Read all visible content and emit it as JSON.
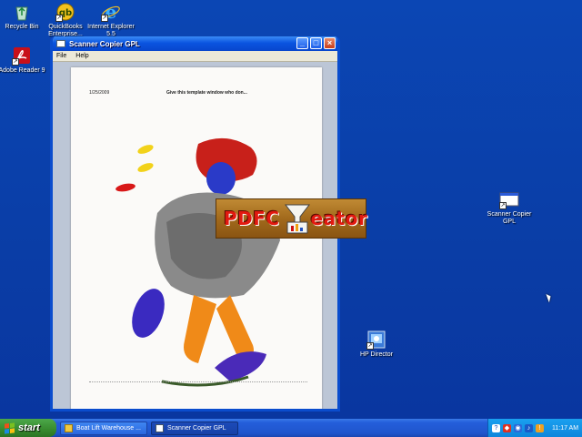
{
  "desktop": {
    "icons": [
      {
        "label": "Recycle Bin",
        "icon": "recycle-bin-icon"
      },
      {
        "label": "QuickBooks Enterprise...",
        "icon": "quickbooks-icon"
      },
      {
        "label": "Internet Explorer 5.5",
        "icon": "internet-explorer-icon"
      },
      {
        "label": "Adobe Reader 9",
        "icon": "adobe-reader-icon"
      },
      {
        "label": "Scanner Copier GPL",
        "icon": "scanner-copier-icon"
      },
      {
        "label": "HP Director",
        "icon": "hp-director-icon"
      }
    ]
  },
  "window": {
    "title": "Scanner Copier GPL",
    "minimize": "_",
    "maximize": "□",
    "close": "×",
    "menu": [
      "File",
      "Help"
    ],
    "document": {
      "date": "1/25/2009",
      "heading": "Give this template window who don..."
    }
  },
  "splash": {
    "text": "PDFCreator",
    "text_left": "PDFC",
    "text_right": "eator"
  },
  "taskbar": {
    "start_label": "start",
    "tasks": [
      {
        "label": "Boat Lift Warehouse ...",
        "active": false
      },
      {
        "label": "Scanner Copier GPL",
        "active": true
      }
    ],
    "clock": "11:17 AM"
  },
  "colors": {
    "desktop": "#0b3ea8",
    "title_bar": "#0a54e0",
    "start_button": "#378a2e",
    "splash_text": "#e21a10"
  }
}
